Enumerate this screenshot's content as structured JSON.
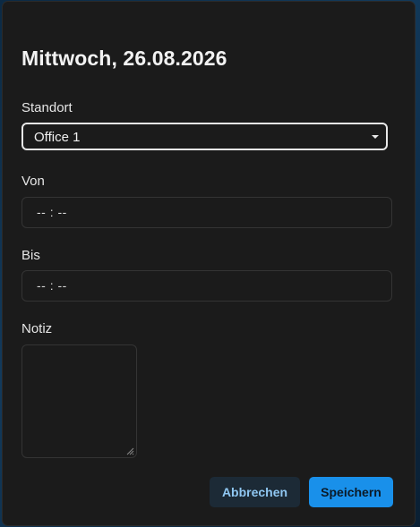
{
  "dialog": {
    "title": "Mittwoch, 26.08.2026"
  },
  "form": {
    "location": {
      "label": "Standort",
      "value": "Office 1"
    },
    "from": {
      "label": "Von",
      "value": "-- : --"
    },
    "to": {
      "label": "Bis",
      "value": "-- : --"
    },
    "note": {
      "label": "Notiz",
      "value": ""
    }
  },
  "actions": {
    "cancel_label": "Abbrechen",
    "save_label": "Speichern"
  },
  "colors": {
    "dialog_bg": "#1b1b1b",
    "primary": "#1990ea",
    "secondary_bg": "#1c2a36",
    "secondary_text": "#8fc7f2"
  },
  "icons": {
    "select_caret": "caret-down-icon",
    "resize_grip": "resize-grip-icon"
  }
}
